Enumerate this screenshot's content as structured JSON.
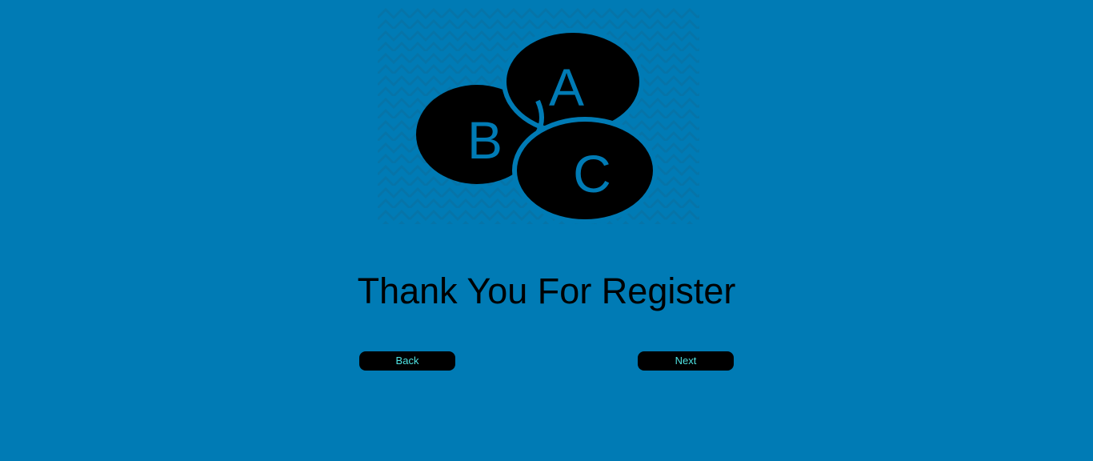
{
  "logo": {
    "letters": [
      "A",
      "B",
      "C"
    ],
    "circle_color": "#000000",
    "letter_color": "#007bb5"
  },
  "colors": {
    "background": "#007bb5",
    "button_bg": "#000000",
    "button_text": "#4fe3e3"
  },
  "heading": "Thank You For Register",
  "buttons": {
    "back_label": "Back",
    "next_label": "Next"
  }
}
